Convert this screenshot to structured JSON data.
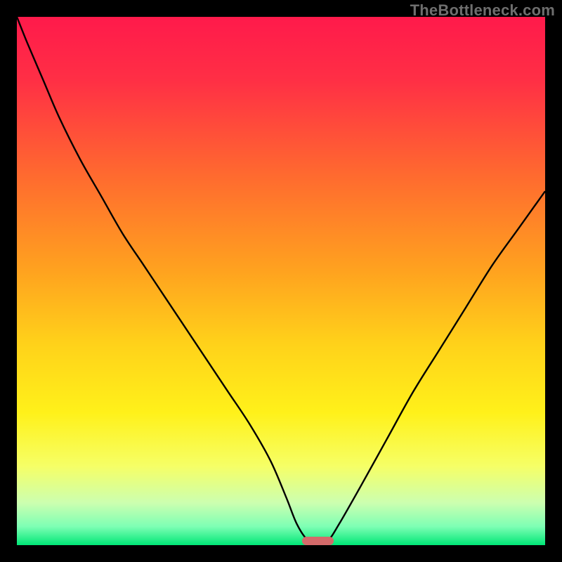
{
  "watermark": "TheBottleneck.com",
  "colors": {
    "frame": "#000000",
    "watermark": "#6e6e6e",
    "curve": "#000000",
    "marker": "#d46a6a",
    "gradient_stops": [
      {
        "offset": 0.0,
        "color": "#ff1a4b"
      },
      {
        "offset": 0.12,
        "color": "#ff2f45"
      },
      {
        "offset": 0.3,
        "color": "#ff6a2f"
      },
      {
        "offset": 0.48,
        "color": "#ffa21f"
      },
      {
        "offset": 0.62,
        "color": "#ffd21a"
      },
      {
        "offset": 0.75,
        "color": "#fff11a"
      },
      {
        "offset": 0.85,
        "color": "#f6ff66"
      },
      {
        "offset": 0.92,
        "color": "#ccffb0"
      },
      {
        "offset": 0.965,
        "color": "#7dffb4"
      },
      {
        "offset": 1.0,
        "color": "#00e676"
      }
    ]
  },
  "chart_data": {
    "type": "line",
    "title": "",
    "xlabel": "",
    "ylabel": "",
    "xlim": [
      0,
      100
    ],
    "ylim": [
      0,
      100
    ],
    "x": [
      0,
      2,
      5,
      8,
      12,
      16,
      20,
      24,
      28,
      32,
      36,
      40,
      44,
      48,
      51,
      53,
      55,
      57,
      59,
      61,
      65,
      70,
      75,
      80,
      85,
      90,
      95,
      100
    ],
    "values": [
      100,
      95,
      88,
      81,
      73,
      66,
      59,
      53,
      47,
      41,
      35,
      29,
      23,
      16,
      9,
      4,
      1,
      0.2,
      1,
      4,
      11,
      20,
      29,
      37,
      45,
      53,
      60,
      67
    ],
    "min_x": 57,
    "min_value": 0.2,
    "marker": {
      "x_start": 54,
      "x_end": 60,
      "y": 0
    }
  }
}
